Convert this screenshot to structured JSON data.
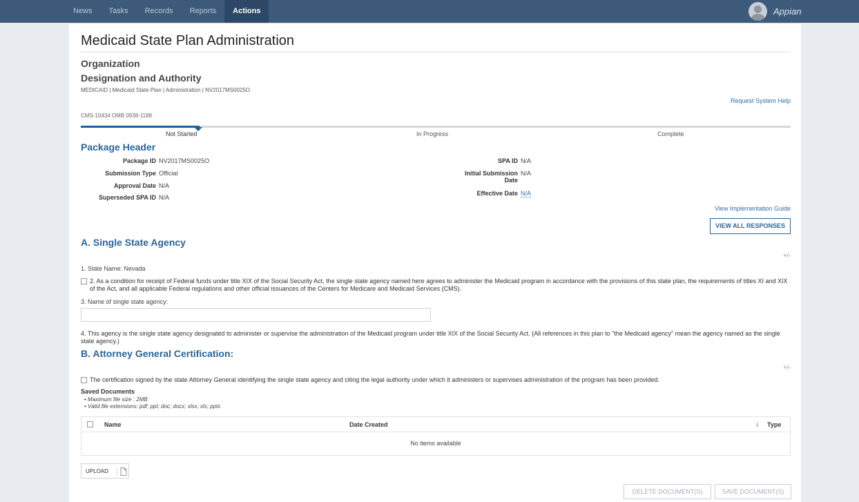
{
  "nav": {
    "items": [
      "News",
      "Tasks",
      "Records",
      "Reports",
      "Actions"
    ],
    "active": "Actions",
    "brand": "Appian"
  },
  "page": {
    "title": "Medicaid State Plan Administration",
    "subtitle1": "Organization",
    "subtitle2": "Designation and Authority",
    "breadcrumb": "MEDICAID | Medicaid State Plan | Administration | NV2017MS0025O",
    "request_help": "Request System Help",
    "cms_number": "CMS-10434 OMB 0938-1188"
  },
  "progress": {
    "steps": [
      "Not Started",
      "In Progress",
      "Complete"
    ],
    "current": "Not Started"
  },
  "package_header": {
    "title": "Package Header",
    "package_id_label": "Package ID",
    "package_id": "NV2017MS0025O",
    "submission_type_label": "Submission Type",
    "submission_type": "Official",
    "approval_date_label": "Approval Date",
    "approval_date": "N/A",
    "superseded_label": "Superseded SPA ID",
    "superseded": "N/A",
    "spa_id_label": "SPA ID",
    "spa_id": "N/A",
    "initial_submission_label_1": "Initial Submission",
    "initial_submission_label_2": "Date",
    "initial_submission": "N/A",
    "effective_date_label": "Effective Date",
    "effective_date": "N/A"
  },
  "links": {
    "implementation_guide": "View Implementation Guide",
    "view_all_responses": "VIEW ALL RESPONSES"
  },
  "section_a": {
    "title": "A. Single State Agency",
    "toggle": "+/-",
    "state_name": "1. State Name: Nevada",
    "item2": "2. As a condition for receipt of Federal funds under title XIX of the Social Security Act, the single state agency named here agrees to administer the Medicaid program in accordance with the provisions of this state plan, the requirements of titles XI and XIX of the Act, and all applicable Federal regulations and other official issuances of the Centers for Medicare and Medicaid Services (CMS).",
    "item3": "3. Name of single state agency:",
    "agency_name_value": "",
    "item4": "4. This agency is the single state agency designated to administer or supervise the administration of the Medicaid program under title XIX of the Social Security Act. (All references in this plan to \"the Medicaid agency\" mean the agency named as the single state agency.)"
  },
  "section_b": {
    "title": "B. Attorney General Certification:",
    "toggle": "+/-",
    "certification": "The certification signed by the state Attorney General identifying the single state agency and citing the legal authority under which it administers or supervises administration of the program has been provided.",
    "saved_documents": "Saved Documents",
    "rules": [
      "Maximum file size : 2MB",
      "Valid file extensions: pdf; ppt; doc; docx; xlsx; xls; pptx"
    ],
    "columns": [
      "Name",
      "Date Created",
      "Type"
    ],
    "empty": "No items available",
    "upload": "UPLOAD",
    "delete_documents": "DELETE DOCUMENT(S)",
    "save_documents": "SAVE DOCUMENT(S)"
  }
}
